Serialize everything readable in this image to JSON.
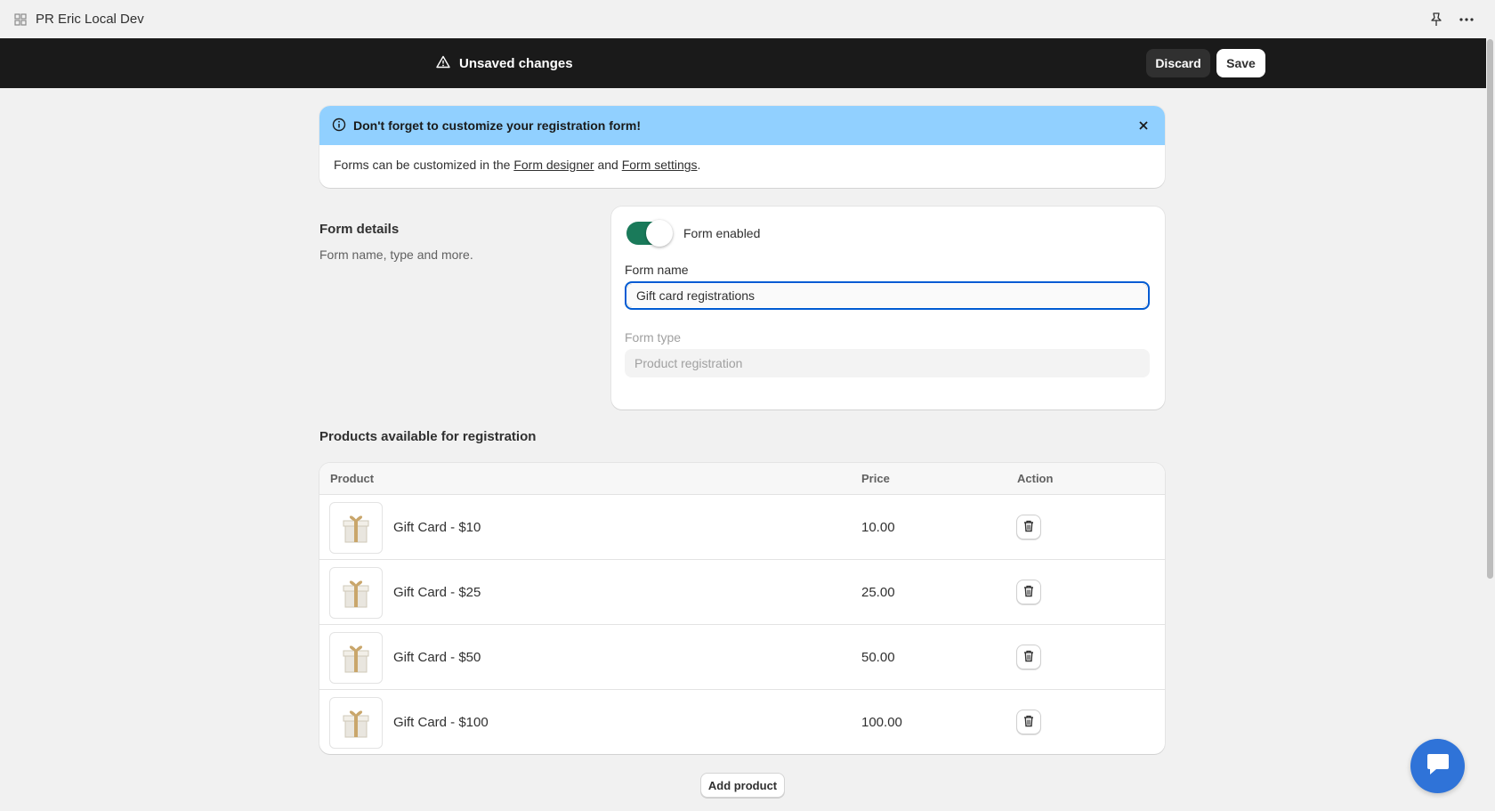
{
  "app": {
    "title": "PR Eric Local Dev",
    "icons": [
      "app-grid-icon",
      "pin-icon",
      "more-horizontal-icon"
    ]
  },
  "savebar": {
    "message": "Unsaved changes",
    "discard_label": "Discard",
    "save_label": "Save"
  },
  "banner": {
    "title": "Don't forget to customize your registration form!",
    "body_prefix": "Forms can be customized in the ",
    "link1": "Form designer",
    "body_mid": " and ",
    "link2": "Form settings",
    "body_suffix": "."
  },
  "form_details": {
    "title": "Form details",
    "subtitle": "Form name, type and more.",
    "toggle_label": "Form enabled",
    "toggle_on": true,
    "name_label": "Form name",
    "name_value": "Gift card registrations",
    "type_label": "Form type",
    "type_value": "Product registration"
  },
  "products": {
    "title": "Products available for registration",
    "columns": [
      "Product",
      "Price",
      "Action"
    ],
    "rows": [
      {
        "name": "Gift Card - $10",
        "price": "10.00"
      },
      {
        "name": "Gift Card - $25",
        "price": "25.00"
      },
      {
        "name": "Gift Card - $50",
        "price": "50.00"
      },
      {
        "name": "Gift Card - $100",
        "price": "100.00"
      }
    ],
    "add_label": "Add product"
  },
  "colors": {
    "savebar_bg": "#1a1a1a",
    "banner_head_bg": "#91d0ff",
    "toggle_on": "#1a7a5a",
    "focus_ring": "#005bd3",
    "chat_bubble": "#2f73d8"
  }
}
